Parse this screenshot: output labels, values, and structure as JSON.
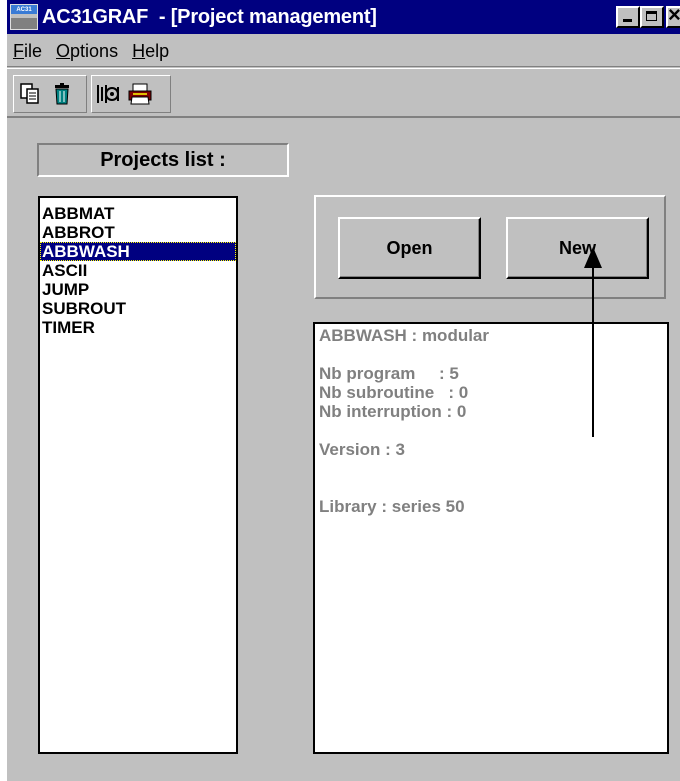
{
  "window": {
    "title": "AC31GRAF  - [Project management]",
    "app_icon_text": "AC31"
  },
  "menu": {
    "items": [
      "File",
      "Options",
      "Help"
    ]
  },
  "toolbar": {
    "buttons": [
      "copy-icon",
      "delete-icon",
      "compile-icon",
      "print-icon"
    ]
  },
  "projects": {
    "label": "Projects list :",
    "items": [
      "ABBMAT",
      "ABBROT",
      "ABBWASH",
      "ASCII",
      "JUMP",
      "SUBROUT",
      "TIMER"
    ],
    "selected_index": 2
  },
  "actions": {
    "open_label": "Open",
    "new_label": "New"
  },
  "info": {
    "lines": [
      "ABBWASH : modular",
      "",
      "Nb program     : 5",
      "Nb subroutine   : 0",
      "Nb interruption : 0",
      "",
      "Version : 3",
      "",
      "",
      "Library : series 50"
    ]
  },
  "colors": {
    "titlebar": "#000080",
    "window_bg": "#c0c0c0",
    "selection": "#000080",
    "info_text": "#808080"
  }
}
